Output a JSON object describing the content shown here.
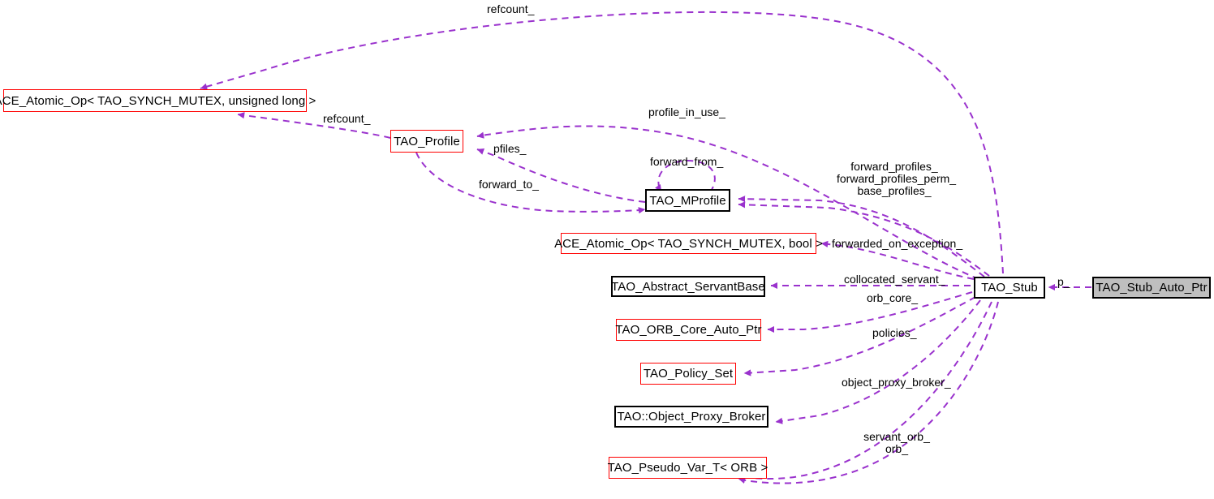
{
  "diagram": {
    "kind": "collaboration-diagram",
    "root_class": "TAO_Stub_Auto_Ptr",
    "colors": {
      "edge": "#9a32cd",
      "node_border_default": "#000000",
      "node_border_highlight": "#ff0000",
      "node_fill_default": "#ffffff",
      "node_fill_current": "#bfbfbf",
      "text": "#000000",
      "background": "#ffffff"
    }
  },
  "nodes": [
    {
      "id": "ace_atomic_ulong",
      "label": "ACE_Atomic_Op< TAO_SYNCH_MUTEX, unsigned long >",
      "style": "red"
    },
    {
      "id": "tao_profile",
      "label": "TAO_Profile",
      "style": "red"
    },
    {
      "id": "tao_mprofile",
      "label": "TAO_MProfile",
      "style": "black"
    },
    {
      "id": "ace_atomic_bool",
      "label": "ACE_Atomic_Op< TAO_SYNCH_MUTEX, bool >",
      "style": "red"
    },
    {
      "id": "tao_abstract_servantbase",
      "label": "TAO_Abstract_ServantBase",
      "style": "black"
    },
    {
      "id": "tao_orb_core_auto_ptr",
      "label": "TAO_ORB_Core_Auto_Ptr",
      "style": "red"
    },
    {
      "id": "tao_policy_set",
      "label": "TAO_Policy_Set",
      "style": "red"
    },
    {
      "id": "tao_object_proxy_broker",
      "label": "TAO::Object_Proxy_Broker",
      "style": "black"
    },
    {
      "id": "tao_pseudo_var_t_orb",
      "label": "TAO_Pseudo_Var_T< ORB >",
      "style": "red"
    },
    {
      "id": "tao_stub",
      "label": "TAO_Stub",
      "style": "black"
    },
    {
      "id": "tao_stub_auto_ptr",
      "label": "TAO_Stub_Auto_Ptr",
      "style": "filled"
    }
  ],
  "edge_labels": [
    {
      "id": "refcount_top",
      "text": "refcount_",
      "from": "tao_stub",
      "to": "ace_atomic_ulong"
    },
    {
      "id": "refcount_profile",
      "text": "refcount_",
      "from": "tao_profile",
      "to": "ace_atomic_ulong"
    },
    {
      "id": "profile_in_use_",
      "text": "profile_in_use_",
      "from": "tao_stub",
      "to": "tao_profile"
    },
    {
      "id": "pfiles_",
      "text": "pfiles_",
      "from": "tao_mprofile",
      "to": "tao_profile"
    },
    {
      "id": "forward_to_",
      "text": "forward_to_",
      "from": "tao_profile",
      "to": "tao_mprofile"
    },
    {
      "id": "forward_from_",
      "text": "forward_from_",
      "from": "tao_mprofile",
      "to": "tao_mprofile"
    },
    {
      "id": "forward_profiles_group",
      "text": "forward_profiles_\nforward_profiles_perm_\nbase_profiles_",
      "from": "tao_stub",
      "to": "tao_mprofile"
    },
    {
      "id": "forwarded_on_exception_",
      "text": "forwarded_on_exception_",
      "from": "tao_stub",
      "to": "ace_atomic_bool"
    },
    {
      "id": "collocated_servant_",
      "text": "collocated_servant_",
      "from": "tao_stub",
      "to": "tao_abstract_servantbase"
    },
    {
      "id": "orb_core_",
      "text": "orb_core_",
      "from": "tao_stub",
      "to": "tao_orb_core_auto_ptr"
    },
    {
      "id": "policies_",
      "text": "policies_",
      "from": "tao_stub",
      "to": "tao_policy_set"
    },
    {
      "id": "object_proxy_broker_",
      "text": "object_proxy_broker_",
      "from": "tao_stub",
      "to": "tao_object_proxy_broker"
    },
    {
      "id": "servant_orb_group",
      "text": "servant_orb_\norb_",
      "from": "tao_stub",
      "to": "tao_pseudo_var_t_orb"
    },
    {
      "id": "p_",
      "text": "p_",
      "from": "tao_stub_auto_ptr",
      "to": "tao_stub"
    }
  ]
}
